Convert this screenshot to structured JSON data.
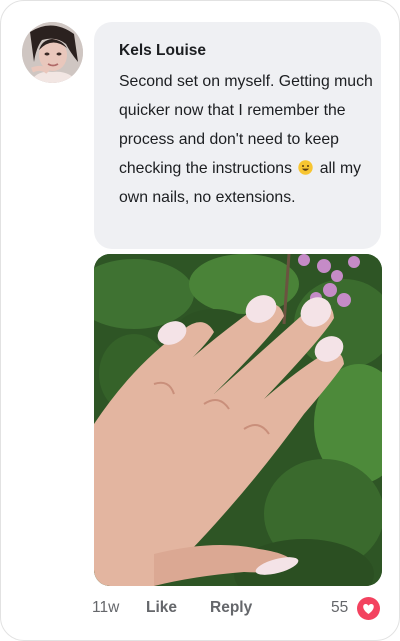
{
  "comment": {
    "author": "Kels Louise",
    "text_before_emoji": "Second set on myself. Getting much quicker now that I remember the process and don't need to keep checking the instructions",
    "emoji": "grinning-face-emoji",
    "text_after_emoji": "all my own nails, no extensions.",
    "photo": "nails-photo"
  },
  "footer": {
    "time": "11w",
    "like_label": "Like",
    "reply_label": "Reply",
    "reaction_count": "55",
    "reaction_icon": "heart-icon"
  },
  "colors": {
    "bubble": "#eff0f3",
    "meta_text": "#65676b",
    "heart": "#f3425f"
  }
}
